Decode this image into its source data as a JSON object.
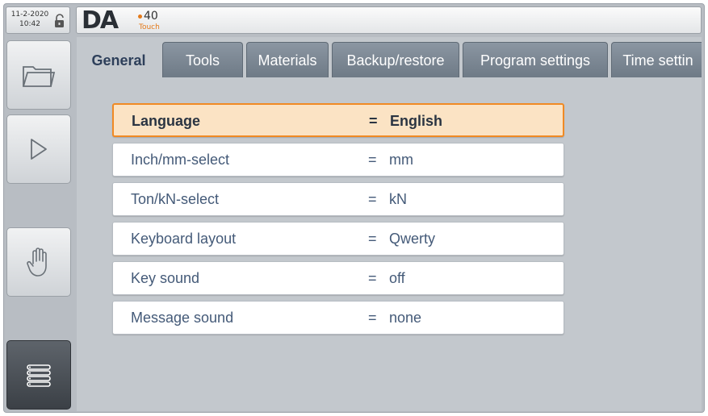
{
  "clock": {
    "date": "11-2-2020",
    "time": "10:42"
  },
  "logo": {
    "brand": "DA",
    "model": "40",
    "sub": "Touch",
    "accent": "#e47a1a"
  },
  "tabs": [
    {
      "label": "General",
      "active": true
    },
    {
      "label": "Tools"
    },
    {
      "label": "Materials"
    },
    {
      "label": "Backup/restore"
    },
    {
      "label": "Program settings"
    },
    {
      "label": "Time settin"
    }
  ],
  "settings": [
    {
      "label": "Language",
      "eq": "=",
      "value": "English",
      "selected": true
    },
    {
      "label": "Inch/mm-select",
      "eq": "=",
      "value": "mm"
    },
    {
      "label": "Ton/kN-select",
      "eq": "=",
      "value": "kN"
    },
    {
      "label": "Keyboard layout",
      "eq": "=",
      "value": "Qwerty"
    },
    {
      "label": "Key sound",
      "eq": "=",
      "value": "off"
    },
    {
      "label": "Message sound",
      "eq": "=",
      "value": "none"
    }
  ],
  "sidebar": {
    "buttons": [
      {
        "icon": "folder-icon"
      },
      {
        "icon": "play-icon"
      },
      {
        "icon": "hand-icon"
      },
      {
        "icon": "list-menu-icon"
      }
    ]
  },
  "colors": {
    "selected_border": "#f08a24",
    "selected_fill": "#fbe3c4",
    "tab_fill": "#7d8893"
  }
}
